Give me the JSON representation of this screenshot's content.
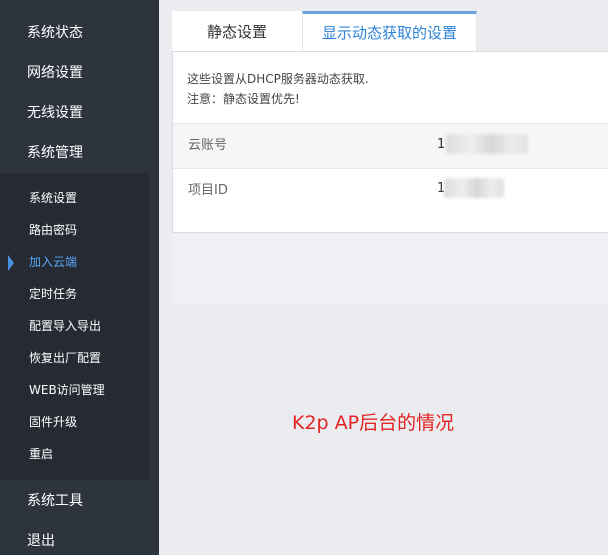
{
  "sidebar": {
    "top_items": [
      {
        "label": "系统状态"
      },
      {
        "label": "网络设置"
      },
      {
        "label": "无线设置"
      },
      {
        "label": "系统管理"
      }
    ],
    "sub_items": [
      {
        "label": "系统设置"
      },
      {
        "label": "路由密码"
      },
      {
        "label": "加入云端",
        "active": true
      },
      {
        "label": "定时任务"
      },
      {
        "label": "配置导入导出"
      },
      {
        "label": "恢复出厂配置"
      },
      {
        "label": "WEB访问管理"
      },
      {
        "label": "固件升级"
      },
      {
        "label": "重启"
      }
    ],
    "bottom_items": [
      {
        "label": "系统工具"
      },
      {
        "label": "退出"
      }
    ],
    "active_color": "#5aa7f5"
  },
  "tabs": [
    {
      "label": "静态设置",
      "active": false
    },
    {
      "label": "显示动态获取的设置",
      "active": true
    }
  ],
  "notice": {
    "line1": "这些设置从DHCP服务器动态获取.",
    "line2": "注意：静态设置优先!"
  },
  "fields": [
    {
      "label": "云账号",
      "value": "1"
    },
    {
      "label": "项目ID",
      "value": "1"
    }
  ],
  "annotation": "K2p AP后台的情况"
}
